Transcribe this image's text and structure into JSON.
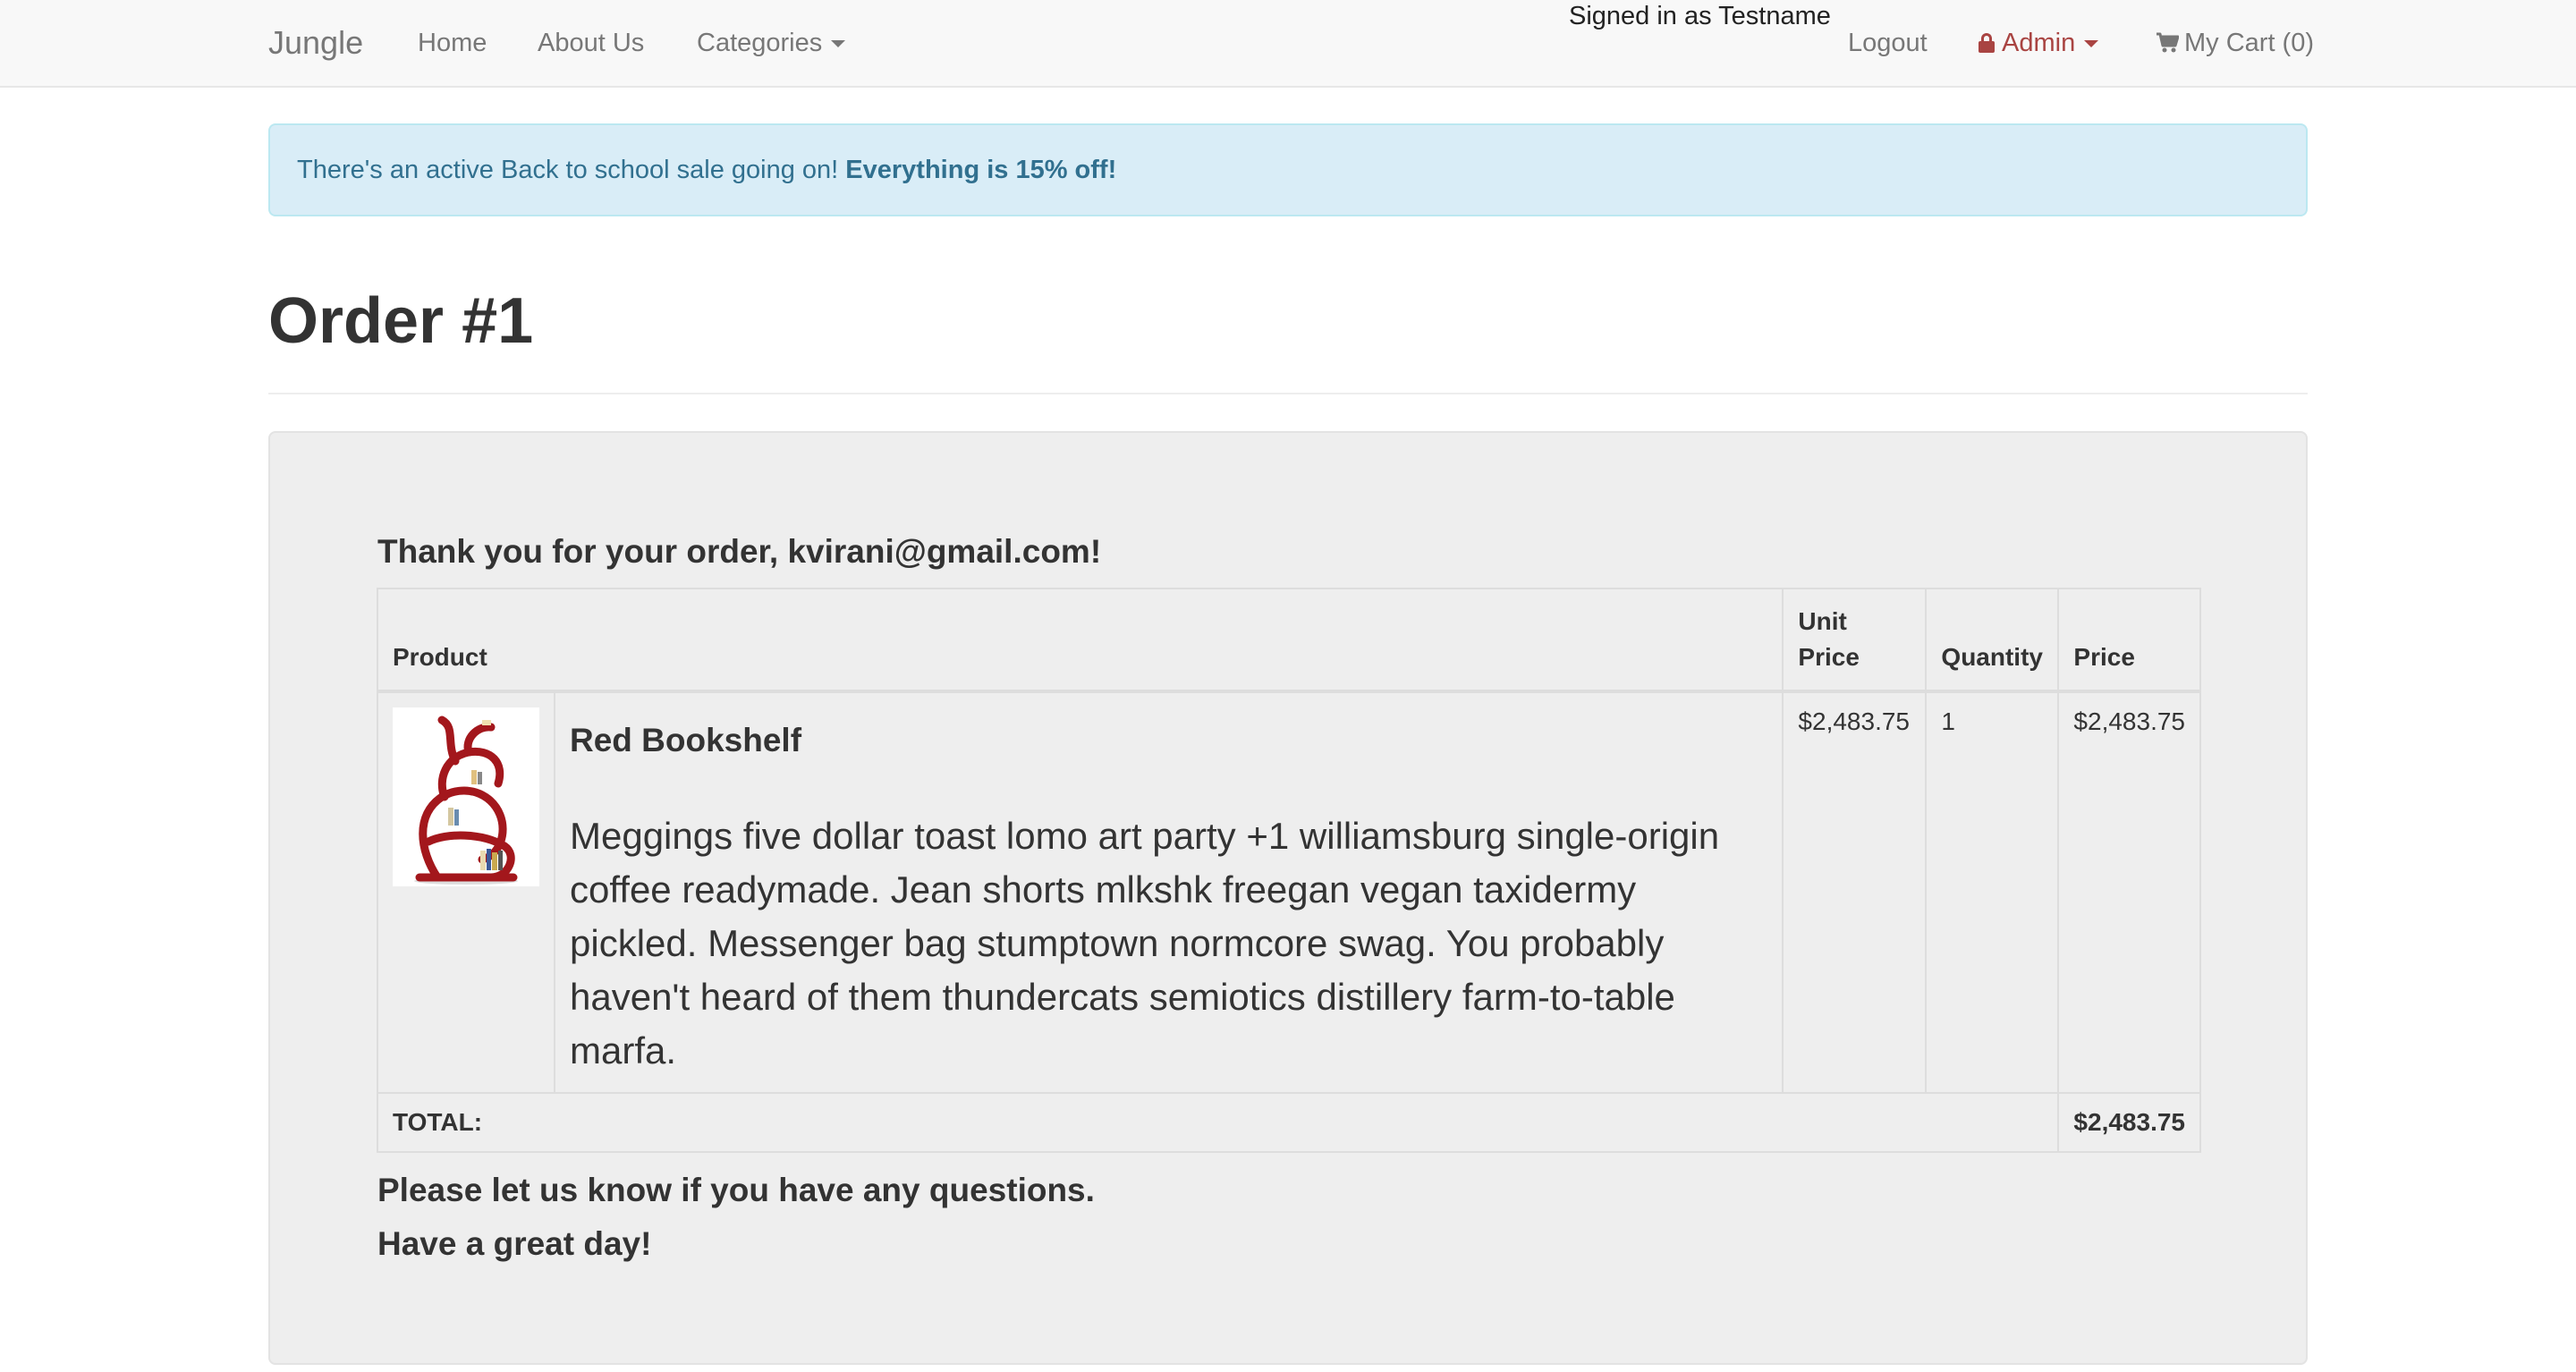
{
  "navbar": {
    "brand": "Jungle",
    "home": "Home",
    "about": "About Us",
    "categories": "Categories",
    "signed_in": "Signed in as Testname",
    "logout": "Logout",
    "admin": "Admin",
    "cart": "My Cart (0)"
  },
  "alert": {
    "text": "There's an active Back to school sale going on! ",
    "emphasis": "Everything is 15% off!"
  },
  "page": {
    "title": "Order #1"
  },
  "order": {
    "thanks": "Thank you for your order, kvirani@gmail.com!",
    "headers": {
      "product": "Product",
      "unit_price": "Unit Price",
      "quantity": "Quantity",
      "price": "Price"
    },
    "items": [
      {
        "name": "Red Bookshelf",
        "description": "Meggings five dollar toast lomo art party +1 williamsburg single-origin coffee readymade. Jean shorts mlkshk freegan vegan taxidermy pickled. Messenger bag stumptown normcore swag. You probably haven't heard of them thundercats semiotics distillery farm-to-table marfa.",
        "unit_price": "$2,483.75",
        "quantity": "1",
        "price": "$2,483.75"
      }
    ],
    "total_label": "TOTAL:",
    "total": "$2,483.75",
    "closing_1": "Please let us know if you have any questions.",
    "closing_2": "Have a great day!"
  },
  "colors": {
    "navbar_bg": "#f8f8f8",
    "alert_bg": "#d9edf7",
    "alert_text": "#31708f",
    "admin_red": "#a94442",
    "well_bg": "#eeeeee"
  },
  "icons": {
    "admin": "lock-icon",
    "cart": "shopping-cart-icon",
    "dropdown": "caret-down-icon"
  }
}
